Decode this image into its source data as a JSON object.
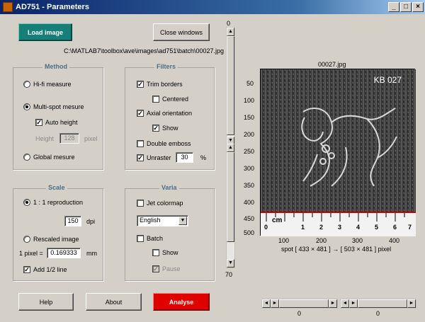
{
  "window": {
    "title": "AD751 - Parameters",
    "min": "_",
    "max": "□",
    "close": "×"
  },
  "top": {
    "load_label": "Load image",
    "close_label": "Close windows",
    "path": "C:\\MATLAB7\\toolbox\\ave\\images\\ad751\\batch\\00027.jpg"
  },
  "method": {
    "title": "Method",
    "hifi": "Hi-fi measure",
    "multispot": "Multi-spot mesure",
    "auto_height": "Auto height",
    "height_label": "Height",
    "height_value": "128",
    "height_unit": "pixel",
    "global": "Global mesure"
  },
  "filters": {
    "title": "Filters",
    "trim": "Trim borders",
    "centered": "Centered",
    "axial": "Axial orientation",
    "show": "Show",
    "double_emboss": "Double emboss",
    "unraster": "Unraster",
    "unraster_value": "30",
    "unraster_unit": "%"
  },
  "scale": {
    "title": "Scale",
    "reproduction": "1 : 1 reproduction",
    "dpi_value": "150",
    "dpi_unit": "dpi",
    "rescaled": "Rescaled image",
    "pixel_label": "1 pixel =",
    "pixel_value": "0.169333",
    "pixel_unit": "mm",
    "add_half": "Add 1/2 line"
  },
  "varia": {
    "title": "Varia",
    "jet": "Jet colormap",
    "language": "English",
    "batch": "Batch",
    "show": "Show",
    "pause": "Pause"
  },
  "bottom": {
    "help": "Help",
    "about": "About",
    "analyse": "Analyse"
  },
  "vslider": {
    "top_label": "0",
    "bottom_label": "70"
  },
  "image_panel": {
    "title": "00027.jpg",
    "stamp": "KB 027",
    "yticks": [
      "50",
      "100",
      "150",
      "200",
      "250",
      "300",
      "350",
      "400",
      "450",
      "500"
    ],
    "xticks": [
      "100",
      "200",
      "300",
      "400"
    ],
    "ruler_unit": "cm",
    "ruler_numbers": [
      "0",
      "1",
      "2",
      "3",
      "4",
      "5",
      "6",
      "7"
    ],
    "caption": "spot [ 433 × 481 ] → [ 503 × 481 ] pixel"
  },
  "hsliders": {
    "left_value": "0",
    "right_value": "0"
  },
  "colors": {
    "accent_teal": "#157f78",
    "analyse_red": "#e00000",
    "red_line": "#c00000"
  }
}
